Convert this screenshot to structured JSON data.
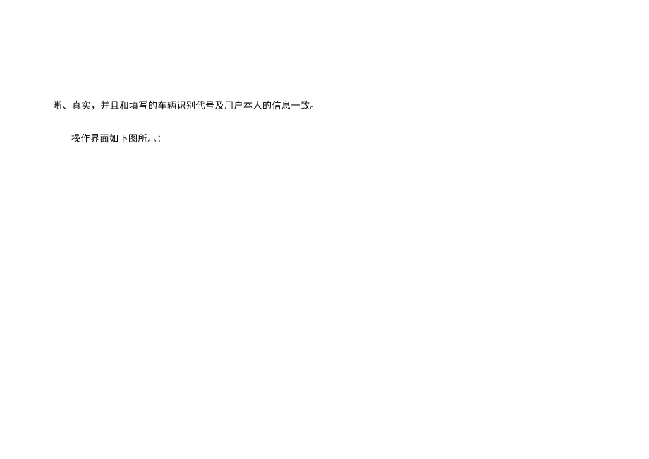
{
  "document": {
    "line1": "晰、真实，并且和填写的车辆识别代号及用户本人的信息一致。",
    "line2": "操作界面如下图所示："
  }
}
